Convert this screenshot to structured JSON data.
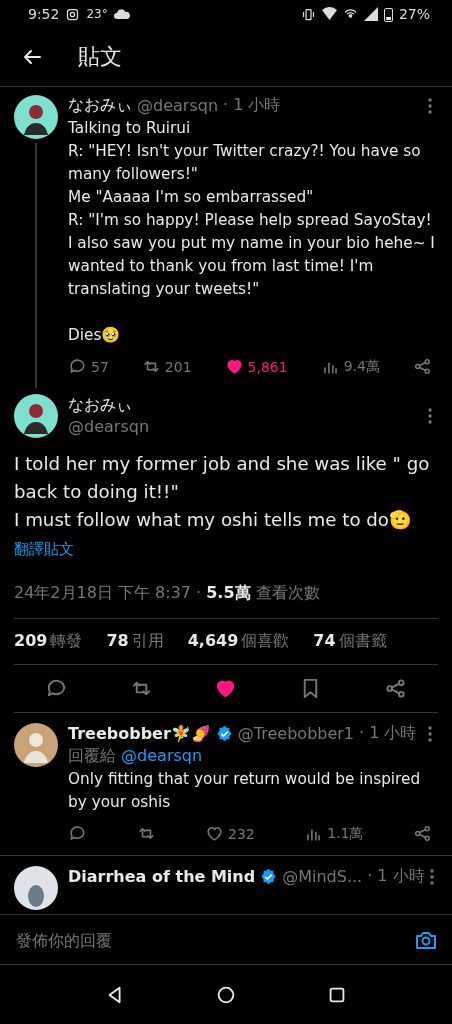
{
  "status_bar": {
    "time": "9:52",
    "temperature": "23°",
    "battery": "27%"
  },
  "header": {
    "title": "貼文"
  },
  "parent_tweet": {
    "name": "なおみぃ",
    "handle": "@dearsqn",
    "time": "· 1 小時",
    "text": "Talking to Ruirui\nR: \"HEY! Isn't your Twitter crazy?! You have so many followers!\"\nMe \"Aaaaa I'm so embarrassed\"\nR: \"I'm so happy! Please help spread SayoStay! I also saw you put my name in your bio hehe~ I wanted to thank you from last time! I'm translating your tweets!\"\n\nDies🥹",
    "replies": "57",
    "reposts": "201",
    "likes": "5,861",
    "liked": true,
    "views": "9.4萬"
  },
  "main_tweet": {
    "name": "なおみぃ",
    "handle": "@dearsqn",
    "text": "I told her my former job and she was like \" go back to doing it!!\"\nI must follow what my oshi tells me to do🫡",
    "translate": "翻譯貼文",
    "timestamp": "24年2月18日 下午 8:37 ·",
    "views": "5.5萬",
    "views_label": "查看次數",
    "counts": [
      "**209** 轉發",
      "**78** 引用",
      "**4,649** 個喜歡",
      "**74** 個書籤"
    ],
    "liked": true
  },
  "replies": [
    {
      "name": "Treebobber🧚🍠",
      "verified": true,
      "handle": "@Treebobber1",
      "time": "· 1 小時",
      "reply_to_label": "回覆給",
      "reply_to": "@dearsqn",
      "text": "Only fitting that your return would be inspired by your oshis",
      "likes": "232",
      "liked": false,
      "views": "1.1萬"
    },
    {
      "name": "Diarrhea of the Mind",
      "verified": true,
      "handle": "@MindS...",
      "time": "· 1 小時"
    }
  ],
  "reply_bar": {
    "placeholder": "發佈你的回覆"
  }
}
